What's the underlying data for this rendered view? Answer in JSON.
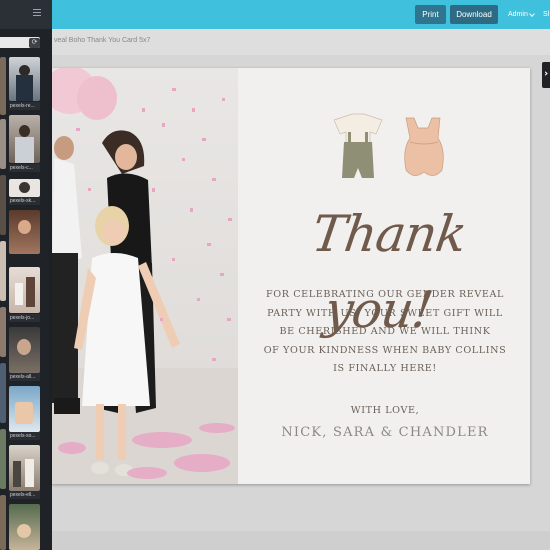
{
  "app": {
    "print_label": "Print",
    "download_label": "Download",
    "admin_label": "Admin",
    "extra_label": "Sl"
  },
  "breadcrumb": "veal Boho Thank You Card 5x7",
  "sidebar": {
    "refresh_glyph": "⟳",
    "thumbs": [
      {
        "label": "pexels-re..."
      },
      {
        "label": "pexels-c..."
      },
      {
        "label": "pexels-sk..."
      },
      {
        "label": "pexels-jo..."
      },
      {
        "label": "pexels-all..."
      },
      {
        "label": "pexels-so..."
      },
      {
        "label": "pexels-ell..."
      }
    ]
  },
  "card": {
    "thank_text": "Thank you!",
    "message_lines": [
      "FOR CELEBRATING OUR GENDER REVEAL",
      "PARTY WITH US! YOUR SWEET GIFT WILL",
      "BE CHERISHED AND WE WILL THINK",
      "OF YOUR KINDNESS WHEN BABY COLLINS",
      "IS FINALLY HERE!"
    ],
    "closing": "WITH LOVE,",
    "names": "NICK, SARA & CHANDLER"
  },
  "colors": {
    "topbar": "#3fc0dd",
    "button": "#2d6b85",
    "text_brown": "#6f5a4c",
    "confetti_pink": "#e7a7c4"
  }
}
